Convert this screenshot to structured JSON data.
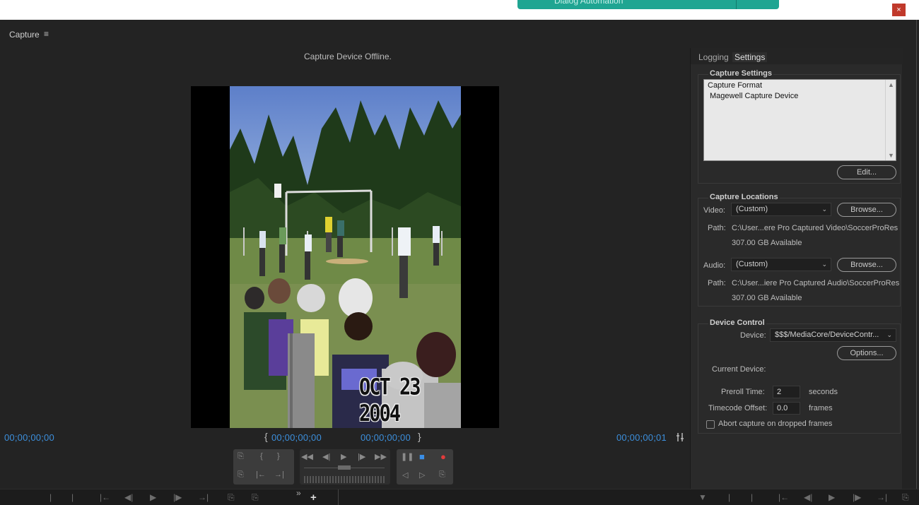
{
  "top": {
    "green_button_text": "Dialog Automation",
    "close": "×"
  },
  "panel": {
    "title": "Capture",
    "menu_icon": "≡"
  },
  "monitor": {
    "status": "Capture Device Offline.",
    "overlay_date": "OCT 23 2004",
    "timecode_current": "00;00;00;00",
    "in_point": "00;00;00;00",
    "out_point": "00;00;00;00",
    "duration": "00;00;00;01",
    "bracket_open": "{",
    "bracket_close": "}"
  },
  "transport": {
    "group1_top": [
      "⎘",
      "{",
      "}"
    ],
    "group1_bottom": [
      "⎘",
      "|←",
      "→|"
    ],
    "group2_top": [
      "◀◀",
      "◀|",
      "▶",
      "|▶",
      "▶▶"
    ],
    "group3_top": [
      "❚❚",
      "■",
      "●"
    ],
    "group3_bottom": [
      "◁",
      "▷",
      "⎘"
    ]
  },
  "bottom_bar": {
    "icons": [
      "|",
      "|",
      "|←",
      "◀|",
      "▶",
      "|▶",
      "→|",
      "⎘",
      "⎘",
      "»",
      "+",
      "▼",
      "|",
      "|",
      "|←",
      "◀|",
      "▶",
      "|▶",
      "→|",
      "⎘"
    ]
  },
  "side": {
    "tabs": {
      "logging": "Logging",
      "settings": "Settings"
    },
    "capture_settings": {
      "title": "Capture Settings",
      "format_label": "Capture Format",
      "format_value": "Magewell Capture Device",
      "edit_button": "Edit..."
    },
    "capture_locations": {
      "title": "Capture Locations",
      "video_label": "Video:",
      "video_select": "(Custom)",
      "browse": "Browse...",
      "video_path_label": "Path:",
      "video_path": "C:\\User...ere Pro Captured Video\\SoccerProRes",
      "video_available": "307.00 GB Available",
      "audio_label": "Audio:",
      "audio_select": "(Custom)",
      "audio_path_label": "Path:",
      "audio_path": "C:\\User...iere Pro Captured Audio\\SoccerProRes",
      "audio_available": "307.00 GB Available"
    },
    "device_control": {
      "title": "Device Control",
      "device_label": "Device:",
      "device_select": "$$$/MediaCore/DeviceContr...",
      "options_button": "Options...",
      "current_device_label": "Current Device:",
      "preroll_label": "Preroll Time:",
      "preroll_value": "2",
      "preroll_unit": "seconds",
      "offset_label": "Timecode Offset:",
      "offset_value": "0.0",
      "offset_unit": "frames",
      "abort_label": "Abort capture on dropped frames"
    }
  },
  "colors": {
    "timecode": "#3c8fdc",
    "record": "#e23b3b",
    "stop": "#3a8ee6",
    "teal": "#1fa592"
  }
}
